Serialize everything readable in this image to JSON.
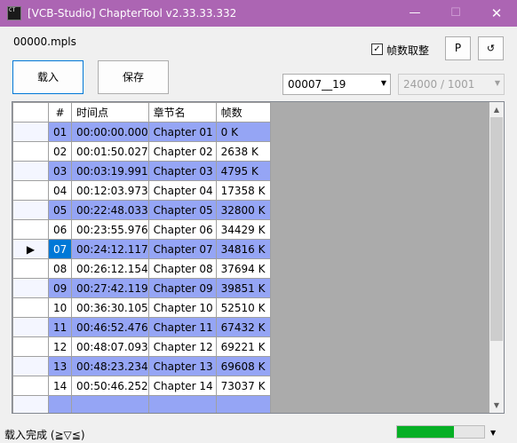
{
  "window": {
    "title": "[VCB-Studio] ChapterTool v2.33.33.332",
    "icon_text": "CT",
    "minimize_glyph": "—",
    "maximize_glyph": "☐",
    "close_glyph": "✕"
  },
  "file": {
    "name": "00000.mpls"
  },
  "options": {
    "round_frames_label": "帧数取整",
    "round_frames_checked": true
  },
  "toolbar": {
    "p_label": "P",
    "refresh_glyph": "↺",
    "load_label": "载入",
    "save_label": "保存"
  },
  "playlist_select": {
    "value": "00007__19",
    "arrow": "▼"
  },
  "fps_select": {
    "value": "24000 / 1001",
    "arrow": "▼"
  },
  "table": {
    "columns": [
      "#",
      "时间点",
      "章节名",
      "帧数"
    ],
    "current_row_marker": "▶",
    "rows": [
      {
        "num": "01",
        "time": "00:00:00.000",
        "name": "Chapter 01",
        "frames": "0 K"
      },
      {
        "num": "02",
        "time": "00:01:50.027",
        "name": "Chapter 02",
        "frames": "2638 K"
      },
      {
        "num": "03",
        "time": "00:03:19.991",
        "name": "Chapter 03",
        "frames": "4795 K"
      },
      {
        "num": "04",
        "time": "00:12:03.973",
        "name": "Chapter 04",
        "frames": "17358 K"
      },
      {
        "num": "05",
        "time": "00:22:48.033",
        "name": "Chapter 05",
        "frames": "32800 K"
      },
      {
        "num": "06",
        "time": "00:23:55.976",
        "name": "Chapter 06",
        "frames": "34429 K"
      },
      {
        "num": "07",
        "time": "00:24:12.117",
        "name": "Chapter 07",
        "frames": "34816 K"
      },
      {
        "num": "08",
        "time": "00:26:12.154",
        "name": "Chapter 08",
        "frames": "37694 K"
      },
      {
        "num": "09",
        "time": "00:27:42.119",
        "name": "Chapter 09",
        "frames": "39851 K"
      },
      {
        "num": "10",
        "time": "00:36:30.105",
        "name": "Chapter 10",
        "frames": "52510 K"
      },
      {
        "num": "11",
        "time": "00:46:52.476",
        "name": "Chapter 11",
        "frames": "67432 K"
      },
      {
        "num": "12",
        "time": "00:48:07.093",
        "name": "Chapter 12",
        "frames": "69221 K"
      },
      {
        "num": "13",
        "time": "00:48:23.234",
        "name": "Chapter 13",
        "frames": "69608 K"
      },
      {
        "num": "14",
        "time": "00:50:46.252",
        "name": "Chapter 14",
        "frames": "73037 K"
      },
      {
        "num": "",
        "time": "",
        "name": "",
        "frames": ""
      }
    ]
  },
  "scrollbar": {
    "up_glyph": "▲",
    "down_glyph": "▼"
  },
  "status": {
    "text": "载入完成 (≧▽≦)",
    "progress": 0.65,
    "progress_color": "#06b025",
    "arrow": "▼"
  },
  "colors": {
    "titlebar": "#ac65b3",
    "row_highlight": "#95a5f5",
    "selected_cell": "#0078d7"
  }
}
